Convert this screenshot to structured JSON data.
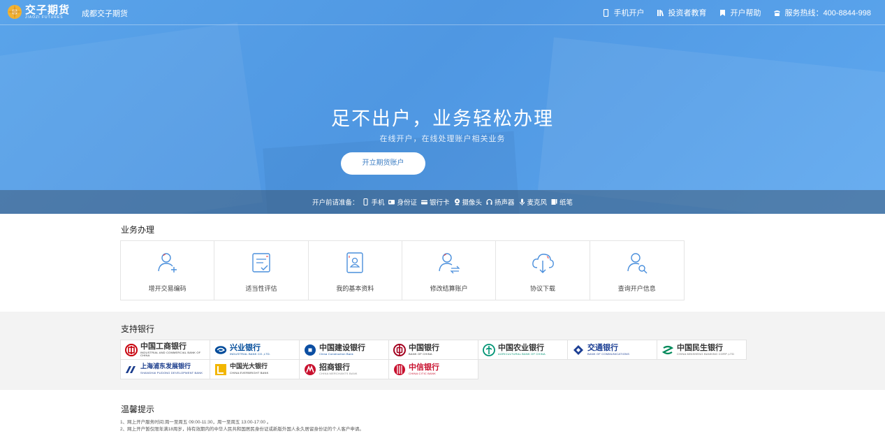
{
  "header": {
    "logo_cn": "交子期货",
    "logo_en": "JIAOZI FUTURES",
    "site_name": "成都交子期货",
    "nav": [
      {
        "icon": "mobile-icon",
        "label": "手机开户"
      },
      {
        "icon": "books-icon",
        "label": "投资者教育"
      },
      {
        "icon": "bookmark-icon",
        "label": "开户帮助"
      },
      {
        "icon": "phone-icon",
        "label": "服务热线：400-8844-998"
      }
    ]
  },
  "hero": {
    "title": "足不出户，业务轻松办理",
    "subtitle": "在线开户，在线处理账户相关业务",
    "cta": "开立期货账户",
    "prep_label": "开户前请准备：",
    "prep_items": [
      {
        "icon": "mobile-icon",
        "label": "手机"
      },
      {
        "icon": "id-card-icon",
        "label": "身份证"
      },
      {
        "icon": "bank-card-icon",
        "label": "银行卡"
      },
      {
        "icon": "camera-icon",
        "label": "摄像头"
      },
      {
        "icon": "headphones-icon",
        "label": "扬声器"
      },
      {
        "icon": "microphone-icon",
        "label": "麦克风"
      },
      {
        "icon": "notebook-icon",
        "label": "纸笔"
      }
    ]
  },
  "business": {
    "title": "业务办理",
    "items": [
      {
        "icon": "add-user-icon",
        "label": "增开交易编码"
      },
      {
        "icon": "checklist-icon",
        "label": "适当性评估"
      },
      {
        "icon": "profile-card-icon",
        "label": "我的基本资料"
      },
      {
        "icon": "user-exchange-icon",
        "label": "修改结算账户"
      },
      {
        "icon": "cloud-download-icon",
        "label": "协议下载"
      },
      {
        "icon": "user-search-icon",
        "label": "查询开户信息"
      }
    ]
  },
  "banks": {
    "title": "支持银行",
    "items": [
      {
        "cn": "中国工商银行",
        "en": "INDUSTRIAL AND COMMERCIAL BANK OF CHINA",
        "color": "#c7000b"
      },
      {
        "cn": "兴业银行",
        "en": "INDUSTRIAL BANK CO.,LTD.",
        "color": "#004b9a"
      },
      {
        "cn": "中国建设银行",
        "en": "China Construction Bank",
        "color": "#0b4ea2"
      },
      {
        "cn": "中国银行",
        "en": "BANK OF CHINA",
        "color": "#a3001e"
      },
      {
        "cn": "中国农业银行",
        "en": "AGRICULTURAL BANK OF CHINA",
        "color": "#009474"
      },
      {
        "cn": "交通银行",
        "en": "BANK OF COMMUNICATIONS",
        "color": "#1c3f94"
      },
      {
        "cn": "中国民生银行",
        "en": "CHINA MINSHENG BANKING CORP.,LTD",
        "color": "#00895a"
      },
      {
        "cn": "上海浦东发展银行",
        "en": "SHANGHAI PUDONG DEVELOPMENT BANK",
        "color": "#1a3c8c"
      },
      {
        "cn": "中国光大银行",
        "en": "CHINA EVERBRIGHT BANK",
        "color": "#f2b600"
      },
      {
        "cn": "招商银行",
        "en": "CHINA MERCHANTS BANK",
        "color": "#c8102e"
      },
      {
        "cn": "中信银行",
        "en": "CHINA CITIC BANK",
        "color": "#c8102e"
      }
    ]
  },
  "tips": {
    "title": "温馨提示",
    "lines": [
      "1、网上开户服务时间:周一至周五 09:00-11:30，周一至周五 13:00-17:00 。",
      "2、网上开户暂仅限年满18周岁，持有效期内的中华人民共和国居民身份证或新版外国人永久居留身份证的个人客户申请。"
    ]
  }
}
